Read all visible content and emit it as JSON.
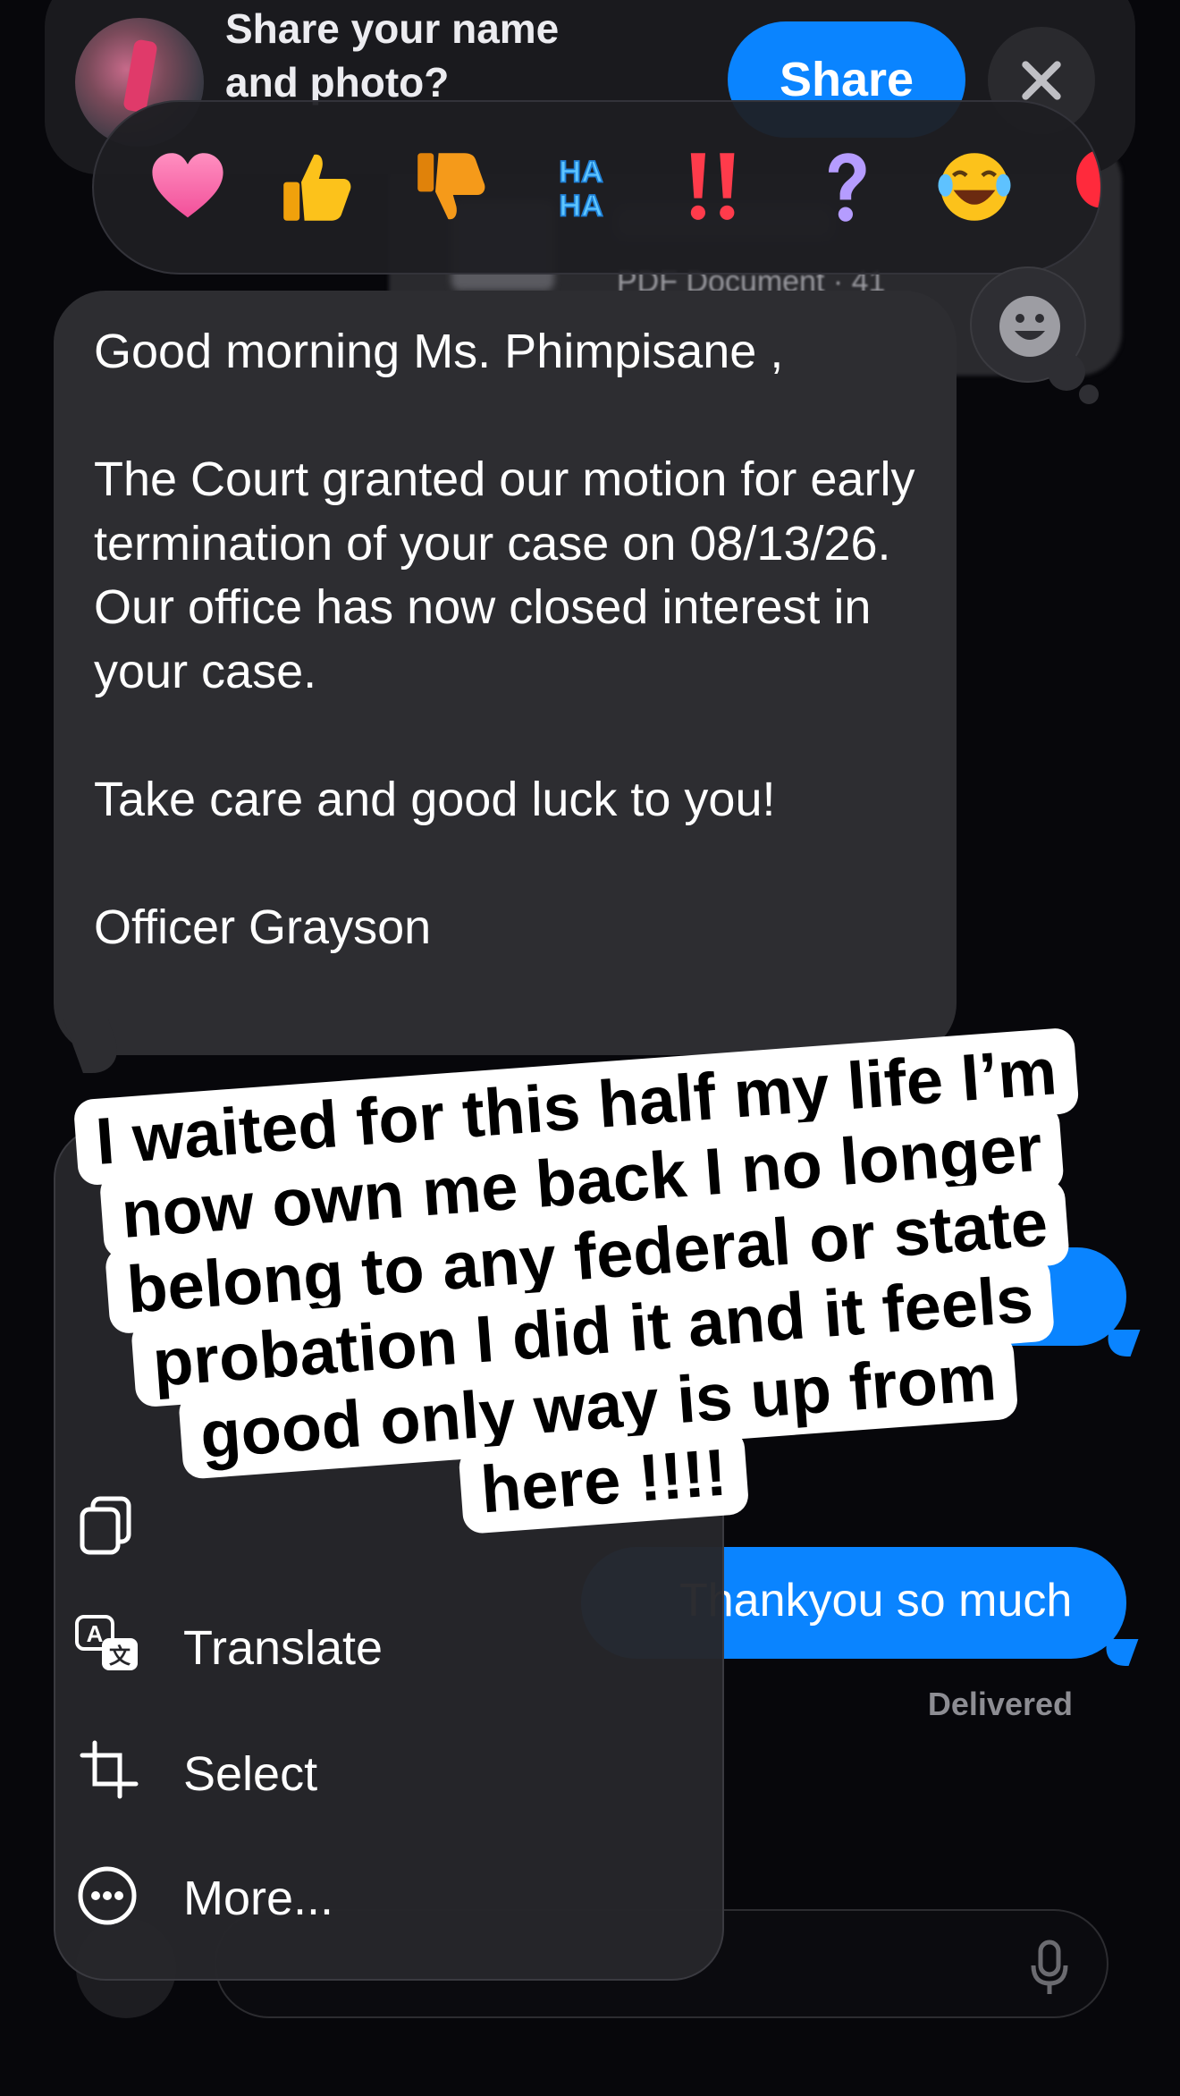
{
  "banner": {
    "prompt": "Share your name and photo?",
    "share_label": "Share",
    "close_icon": "close-icon"
  },
  "conversation_background": {
    "document_subtitle": "PDF Document · 41",
    "reply_text": "Thankyou so  much",
    "reply_status": "Delivered"
  },
  "tapbacks": [
    {
      "name": "heart",
      "glyph": "❤️"
    },
    {
      "name": "thumbs-up",
      "glyph": "👍"
    },
    {
      "name": "thumbs-down",
      "glyph": "👎"
    },
    {
      "name": "haha",
      "glyph": "HA HA"
    },
    {
      "name": "emphasize",
      "glyph": "‼"
    },
    {
      "name": "question",
      "glyph": "?"
    },
    {
      "name": "laughing",
      "glyph": "😂"
    },
    {
      "name": "balloon",
      "glyph": "🎈"
    }
  ],
  "message": {
    "text": "Good morning Ms. Phimpisane ,\n\nThe Court granted our motion for early termination of your case on 08/13/26. Our office has now closed interest in your case.\n\nTake care and good luck to you!\n\nOfficer Grayson"
  },
  "context_menu": {
    "items": [
      {
        "label": "Translate",
        "icon": "translate-icon"
      },
      {
        "label": "Select",
        "icon": "crop-select-icon"
      },
      {
        "label": "More...",
        "icon": "ellipsis-circle-icon"
      }
    ]
  },
  "caption": {
    "lines": [
      "I waited for this half my life I’m",
      "now own me back I no longer",
      "belong to any federal or state",
      "probation I did it and it feels",
      "good only way is  up from",
      "here !!!!"
    ]
  },
  "colors": {
    "background": "#07070b",
    "bubble_gray": "#2d2d31",
    "imessage_blue": "#0a84ff",
    "caption_bg": "#ffffff"
  }
}
